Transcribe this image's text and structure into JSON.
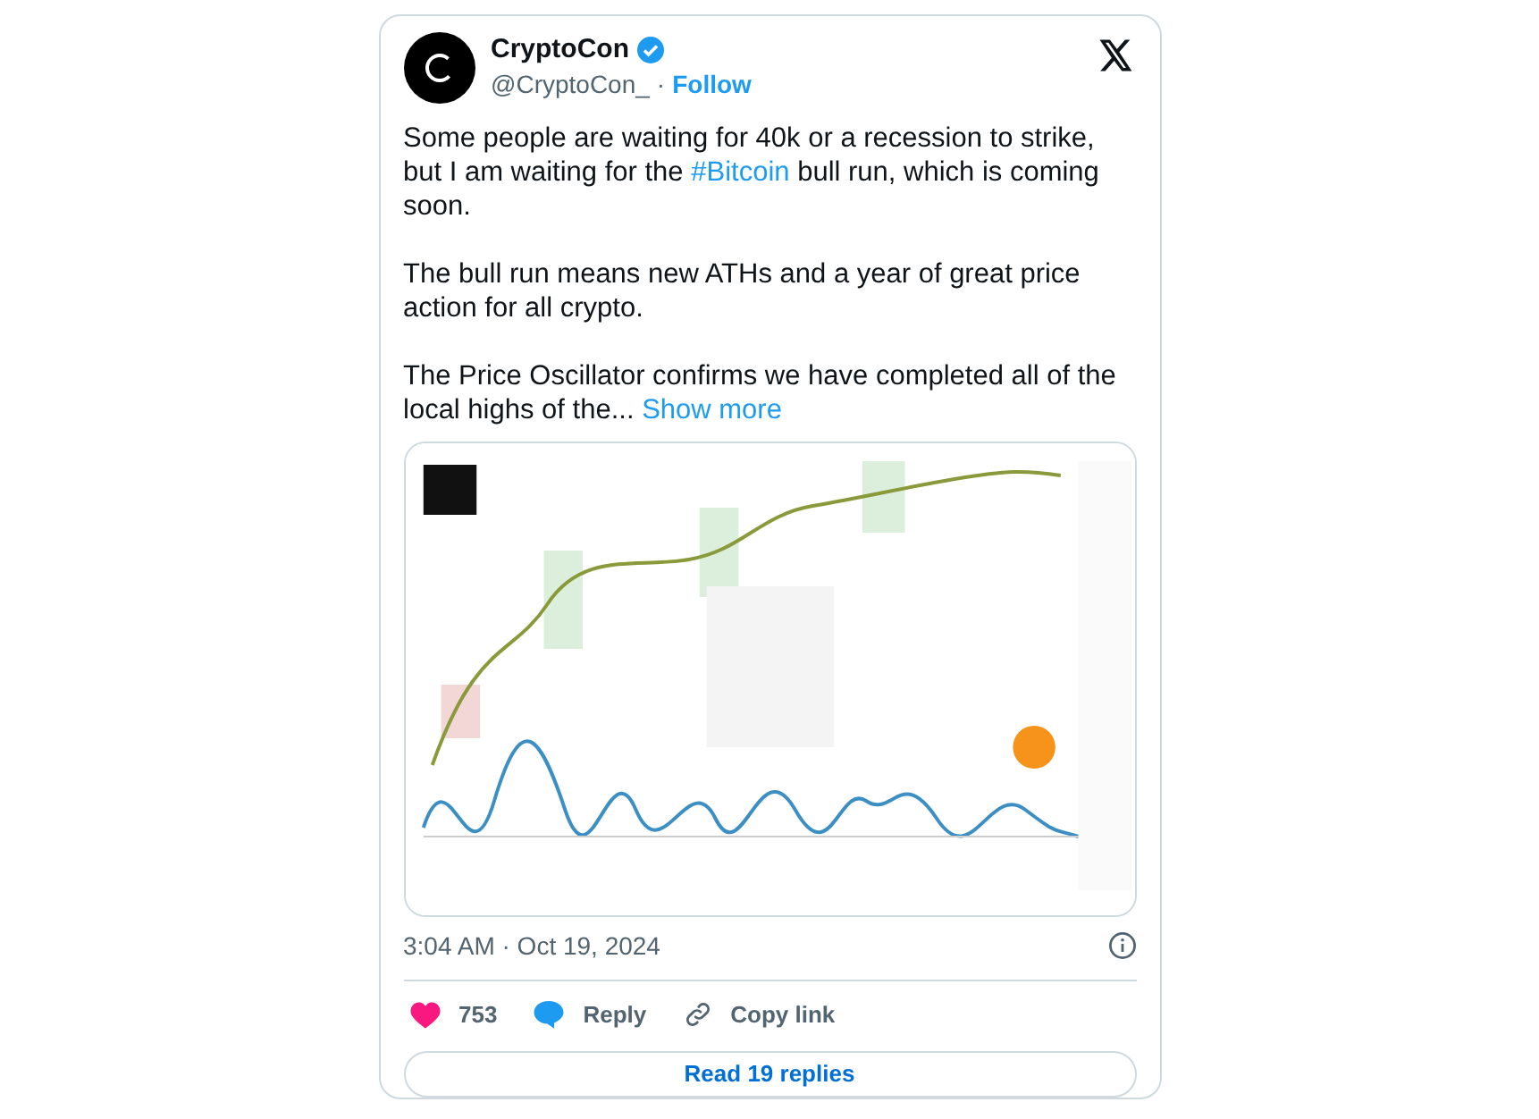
{
  "author": {
    "name": "CryptoCon",
    "verified": true,
    "handle": "@CryptoCon_",
    "separator": "·",
    "follow": "Follow"
  },
  "paragraphs": [
    [
      {
        "kind": "text",
        "text": "Some people are waiting for 40k or a recession to strike, but I am waiting for the "
      },
      {
        "kind": "link",
        "text": "#Bitcoin"
      },
      {
        "kind": "text",
        "text": " bull run, which is coming soon."
      }
    ],
    [
      {
        "kind": "text",
        "text": "The bull run means new ATHs and a year of great price action for all crypto."
      }
    ],
    [
      {
        "kind": "text",
        "text": "The Price Oscillator confirms we have completed all of the local highs of the... "
      },
      {
        "kind": "link",
        "text": "Show more"
      }
    ]
  ],
  "media": {
    "kind": "picture"
  },
  "timestamp": "3:04 AM · Oct 19, 2024",
  "actions": [
    {
      "kind": "like",
      "label": "753"
    },
    {
      "kind": "reply",
      "label": "Reply"
    },
    {
      "kind": "copy",
      "label": "Copy link"
    }
  ],
  "read_replies": "Read 19 replies"
}
